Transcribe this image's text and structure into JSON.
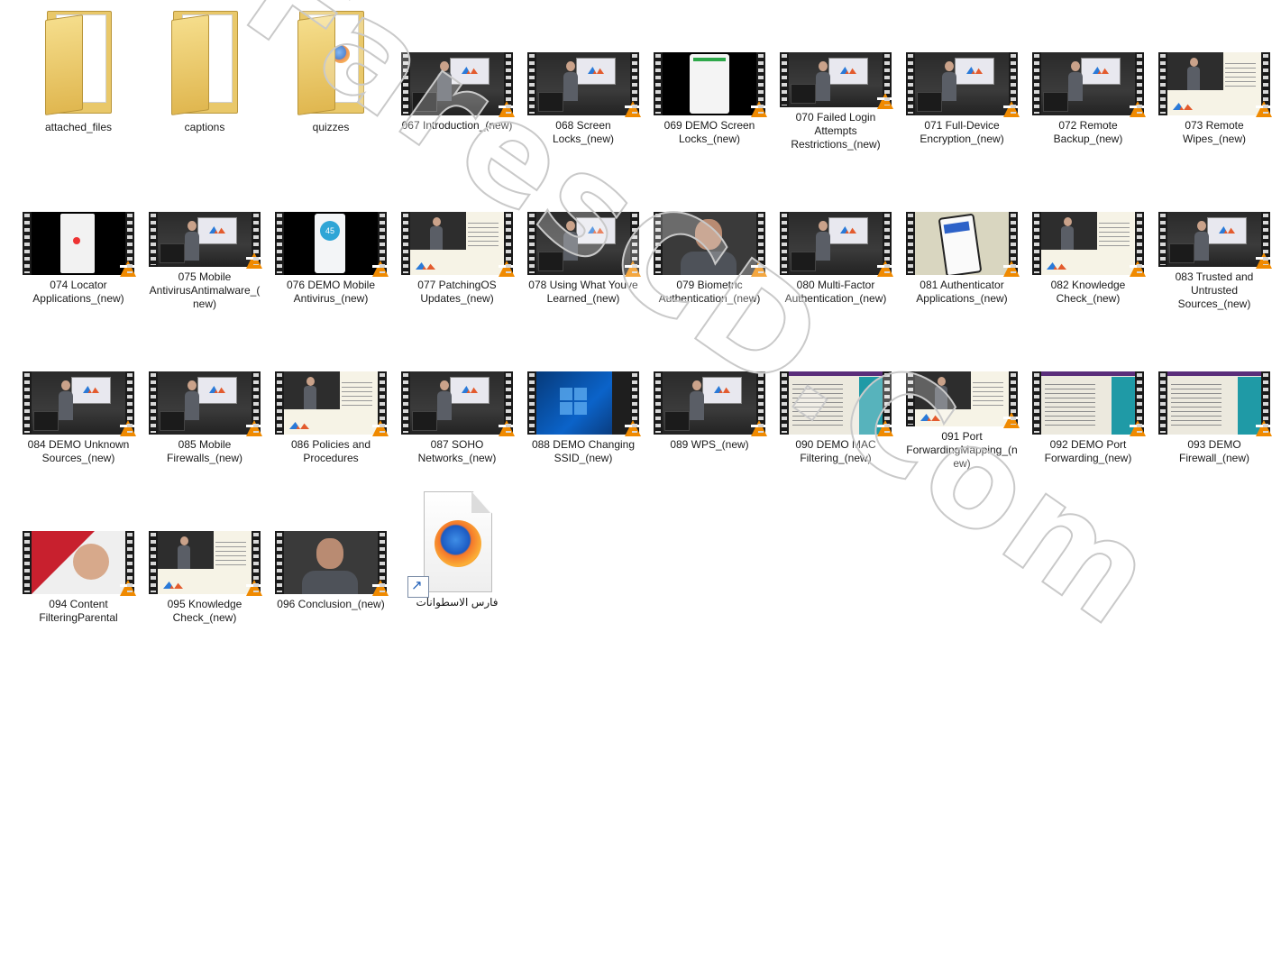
{
  "folders": [
    {
      "name": "attached_files",
      "icon": "folder-icon"
    },
    {
      "name": "captions",
      "icon": "folder-icon"
    },
    {
      "name": "quizzes",
      "icon": "folder-firefox-icon"
    }
  ],
  "videos": [
    {
      "name": "067 Introduction_(new)",
      "scene": "studio"
    },
    {
      "name": "068 Screen Locks_(new)",
      "scene": "studio"
    },
    {
      "name": "069 DEMO Screen Locks_(new)",
      "scene": "phone"
    },
    {
      "name": "070 Failed Login Attempts Restrictions_(new)",
      "scene": "studio"
    },
    {
      "name": "071 Full-Device Encryption_(new)",
      "scene": "studio"
    },
    {
      "name": "072 Remote Backup_(new)",
      "scene": "studio"
    },
    {
      "name": "073 Remote Wipes_(new)",
      "scene": "slide"
    },
    {
      "name": "074 Locator Applications_(new)",
      "scene": "locator"
    },
    {
      "name": "075 Mobile AntivirusAntimalware_(new)",
      "scene": "studio"
    },
    {
      "name": "076 DEMO Mobile Antivirus_(new)",
      "scene": "antivirus"
    },
    {
      "name": "077 PatchingOS Updates_(new)",
      "scene": "slide"
    },
    {
      "name": "078 Using What Youve Learned_(new)",
      "scene": "studio"
    },
    {
      "name": "079 Biometric Authentication_(new)",
      "scene": "face"
    },
    {
      "name": "080 Multi-Factor Authentication_(new)",
      "scene": "studio"
    },
    {
      "name": "081 Authenticator Applications_(new)",
      "scene": "app"
    },
    {
      "name": "082 Knowledge Check_(new)",
      "scene": "slide"
    },
    {
      "name": "083 Trusted and Untrusted Sources_(new)",
      "scene": "studio"
    },
    {
      "name": "084 DEMO Unknown Sources_(new)",
      "scene": "studio"
    },
    {
      "name": "085 Mobile Firewalls_(new)",
      "scene": "studio"
    },
    {
      "name": "086 Policies and Procedures",
      "scene": "slide"
    },
    {
      "name": "087 SOHO Networks_(new)",
      "scene": "studio"
    },
    {
      "name": "088 DEMO Changing SSID_(new)",
      "scene": "win"
    },
    {
      "name": "089 WPS_(new)",
      "scene": "studio"
    },
    {
      "name": "090 DEMO MAC Filtering_(new)",
      "scene": "web"
    },
    {
      "name": "091 Port ForwardingMapping_(new)",
      "scene": "slide"
    },
    {
      "name": "092 DEMO Port Forwarding_(new)",
      "scene": "web"
    },
    {
      "name": "093 DEMO Firewall_(new)",
      "scene": "web"
    },
    {
      "name": "094 Content FilteringParental",
      "scene": "red"
    },
    {
      "name": "095 Knowledge Check_(new)",
      "scene": "slide"
    },
    {
      "name": "096 Conclusion_(new)",
      "scene": "face"
    }
  ],
  "shortcut": {
    "name": "فارس الاسطوانات",
    "icon": "firefox-shortcut-icon"
  },
  "watermark": {
    "text": "FaresCD.Com"
  },
  "colors": {
    "background": "#ffffff",
    "folder": "#e9c86a",
    "vlc_cone": "#f08a00"
  }
}
